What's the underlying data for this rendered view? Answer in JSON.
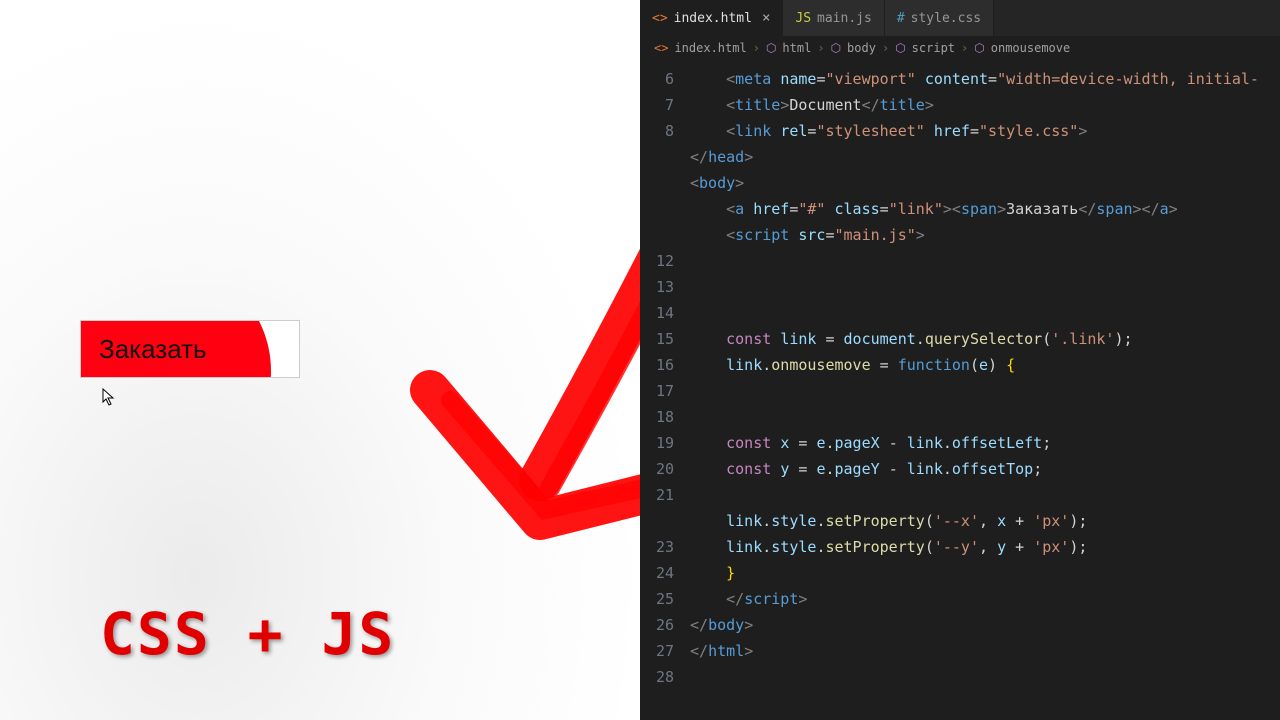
{
  "demo": {
    "button_label": "Заказать",
    "caption": "CSS + JS"
  },
  "editor": {
    "tabs": [
      {
        "icon": "<>",
        "label": "index.html",
        "active": true,
        "closable": true
      },
      {
        "icon": "JS",
        "label": "main.js",
        "active": false,
        "closable": false
      },
      {
        "icon": "#",
        "label": "style.css",
        "active": false,
        "closable": false
      }
    ],
    "breadcrumb": {
      "file_icon": "<>",
      "file": "index.html",
      "parts": [
        "html",
        "body",
        "script",
        "onmousemove"
      ]
    },
    "line_numbers": [
      "6",
      "7",
      "8",
      "",
      "",
      "",
      "",
      "12",
      "13",
      "14",
      "15",
      "16",
      "17",
      "18",
      "19",
      "20",
      "21",
      "",
      "23",
      "24",
      "25",
      "26",
      "27",
      "28"
    ],
    "code": {
      "l6_tag": "meta",
      "l6_attr": "name",
      "l6_val": "\"viewport\"",
      "l6_attr2": "content",
      "l6_val2": "\"width=device-width, initial-",
      "l7_tag": "title",
      "l7_text": "Document",
      "l8_tag": "link",
      "l8_attr": "rel",
      "l8_val": "\"stylesheet\"",
      "l8_attr2": "href",
      "l8_val2": "\"style.css\"",
      "l9_tag": "head",
      "l10_tag": "body",
      "l11_tag": "a",
      "l11_attr": "href",
      "l11_val": "\"#\"",
      "l11_attr2": "class",
      "l11_val2": "\"link\"",
      "l11_span": "span",
      "l11_text": "Заказать",
      "l12_tag": "script",
      "l12_attr": "src",
      "l12_val": "\"main.js\"",
      "l16_kw": "const",
      "l16_var": "link",
      "l16_obj": "document",
      "l16_fn": "querySelector",
      "l16_arg": "'.link'",
      "l17_var": "link",
      "l17_prop": "onmousemove",
      "l17_kw": "function",
      "l17_param": "e",
      "l20_kw": "const",
      "l20_var": "x",
      "l20_param": "e",
      "l20_prop": "pageX",
      "l20_obj": "link",
      "l20_prop2": "offsetLeft",
      "l21_kw": "const",
      "l21_var": "y",
      "l21_param": "e",
      "l21_prop": "pageY",
      "l21_obj": "link",
      "l21_prop2": "offsetTop",
      "l23_obj": "link",
      "l23_prop": "style",
      "l23_fn": "setProperty",
      "l23_a1": "'--x'",
      "l23_v": "x",
      "l23_a2": "'px'",
      "l24_obj": "link",
      "l24_prop": "style",
      "l24_fn": "setProperty",
      "l24_a1": "'--y'",
      "l24_v": "y",
      "l24_a2": "'px'",
      "l26_tag": "script",
      "l27_tag": "body",
      "l28_tag": "html"
    }
  }
}
